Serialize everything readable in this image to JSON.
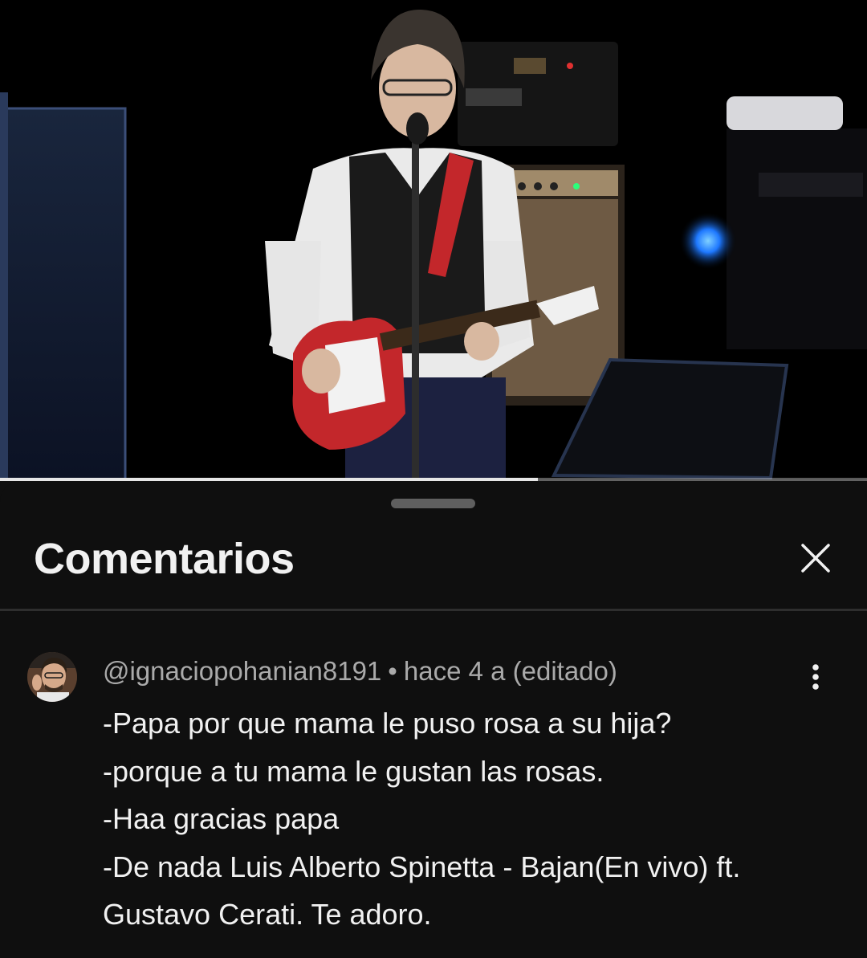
{
  "video": {
    "progress": 0.62
  },
  "panel": {
    "title": "Comentarios",
    "close_icon": "close-icon"
  },
  "comment": {
    "author": "@ignaciopohanian8191",
    "separator": "•",
    "time": "hace 4 a (editado)",
    "menu_icon": "more-vertical-icon",
    "lines": [
      "-Papa por que mama le puso rosa a su hija?",
      "-porque a tu mama le gustan las rosas.",
      "-Haa gracias papa",
      "-De nada Luis Alberto Spinetta - Bajan(En vivo) ft.",
      "Gustavo Cerati. Te adoro."
    ]
  },
  "colors": {
    "background": "#0f0f0f",
    "text_primary": "#f1f1f1",
    "text_secondary": "#aaaaaa",
    "guitar_red": "#c3272b",
    "stage_blue": "#1e78ff"
  }
}
